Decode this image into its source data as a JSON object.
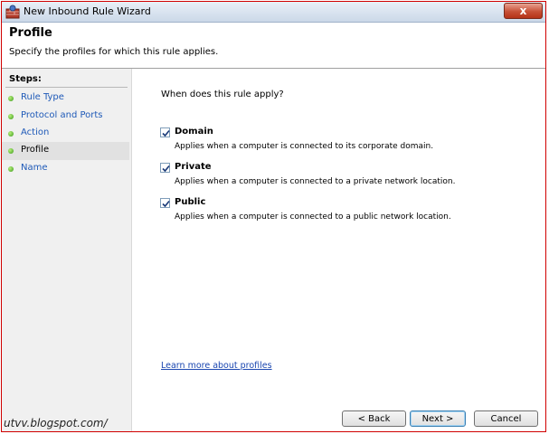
{
  "window": {
    "title": "New Inbound Rule Wizard",
    "close_label": "x"
  },
  "header": {
    "title": "Profile",
    "subtitle": "Specify the profiles for which this rule applies."
  },
  "sidebar": {
    "title": "Steps:",
    "items": [
      {
        "label": "Rule Type",
        "active": false
      },
      {
        "label": "Protocol and Ports",
        "active": false
      },
      {
        "label": "Action",
        "active": false
      },
      {
        "label": "Profile",
        "active": true
      },
      {
        "label": "Name",
        "active": false
      }
    ]
  },
  "main": {
    "question": "When does this rule apply?",
    "options": [
      {
        "label": "Domain",
        "description": "Applies when a computer is connected to its corporate domain.",
        "checked": true
      },
      {
        "label": "Private",
        "description": "Applies when a computer is connected to a private network location.",
        "checked": true
      },
      {
        "label": "Public",
        "description": "Applies when a computer is connected to a public network location.",
        "checked": true
      }
    ],
    "learn_more": "Learn more about profiles"
  },
  "buttons": {
    "back": "< Back",
    "next": "Next >",
    "cancel": "Cancel"
  },
  "watermark": "utvv.blogspot.com/",
  "colors": {
    "accent_link": "#1a46b0",
    "step_link": "#1f5ab8",
    "frame_border": "#d00000",
    "close_button": "#c75036"
  },
  "icons": {
    "app": "firewall-wizard-icon",
    "check": "checkmark-icon",
    "step_bullet": "green-dot-icon"
  }
}
